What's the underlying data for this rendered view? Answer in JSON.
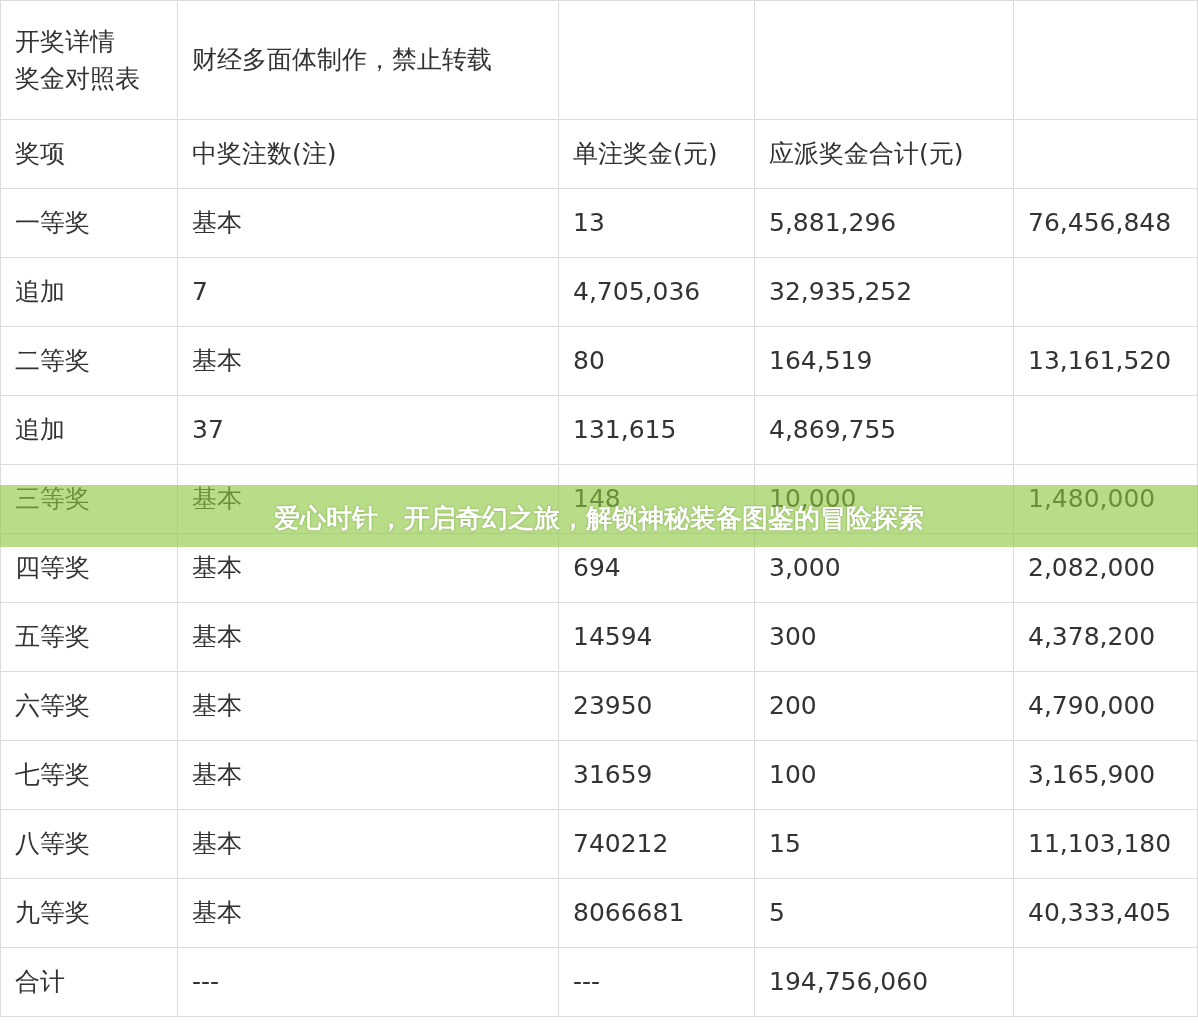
{
  "table": {
    "rows": [
      {
        "cells": [
          [
            "开奖详情",
            "奖金对照表"
          ],
          "财经多面体制作，禁止转载"
        ]
      },
      {
        "cells": [
          "奖项",
          "中奖注数(注)",
          "单注奖金(元)",
          "应派奖金合计(元)"
        ]
      },
      {
        "cells": [
          "一等奖",
          "基本",
          "13",
          "5,881,296",
          "76,456,848"
        ]
      },
      {
        "cells": [
          "追加",
          "7",
          "4,705,036",
          "32,935,252"
        ]
      },
      {
        "cells": [
          "二等奖",
          "基本",
          "80",
          "164,519",
          "13,161,520"
        ]
      },
      {
        "cells": [
          "追加",
          "37",
          "131,615",
          "4,869,755"
        ]
      },
      {
        "cells": [
          "三等奖",
          "基本",
          "148",
          "10,000",
          "1,480,000"
        ]
      },
      {
        "cells": [
          "四等奖",
          "基本",
          "694",
          "3,000",
          "2,082,000"
        ]
      },
      {
        "cells": [
          "五等奖",
          "基本",
          "14594",
          "300",
          "4,378,200"
        ]
      },
      {
        "cells": [
          "六等奖",
          "基本",
          "23950",
          "200",
          "4,790,000"
        ]
      },
      {
        "cells": [
          "七等奖",
          "基本",
          "31659",
          "100",
          "3,165,900"
        ]
      },
      {
        "cells": [
          "八等奖",
          "基本",
          "740212",
          "15",
          "11,103,180"
        ]
      },
      {
        "cells": [
          "九等奖",
          "基本",
          "8066681",
          "5",
          "40,333,405"
        ]
      },
      {
        "cells": [
          "合计",
          "---",
          "---",
          "194,756,060"
        ]
      }
    ]
  },
  "banner": {
    "text": "爱心时针，开启奇幻之旅，解锁神秘装备图鉴的冒险探索"
  }
}
